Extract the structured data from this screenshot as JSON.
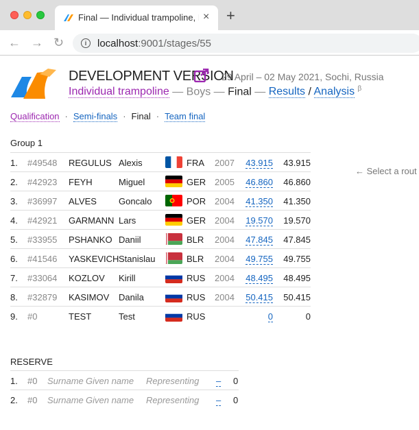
{
  "browser": {
    "tab_title": "Final — Individual trampoline, B",
    "close": "×",
    "new_tab": "+",
    "back": "←",
    "forward": "→",
    "reload": "↻",
    "info": "i",
    "url_host": "localhost",
    "url_path": ":9001/stages/55"
  },
  "header": {
    "title": "DEVELOPMENT VERSION",
    "date_place": "29 April – 02 May 2021, Sochi, Russia",
    "crumb_event": "Individual trampoline",
    "crumb_sep1": " — ",
    "crumb_group": "Boys",
    "crumb_sep2": " — ",
    "crumb_stage": "Final",
    "crumb_sep3": " — ",
    "crumb_results": "Results",
    "crumb_slash": " / ",
    "crumb_analysis": "Analysis",
    "crumb_beta": "β"
  },
  "stage_tabs": {
    "qualification": "Qualification",
    "semi": "Semi-finals",
    "final": "Final",
    "team": "Team final",
    "sep": "·"
  },
  "group": {
    "label": "Group 1",
    "rows": [
      {
        "no": "1.",
        "id": "#49548",
        "surname": "REGULUS",
        "given": "Alexis",
        "flag": "fr",
        "country": "FRA",
        "year": "2007",
        "score": "43.915",
        "total": "43.915"
      },
      {
        "no": "2.",
        "id": "#42923",
        "surname": "FEYH",
        "given": "Miguel",
        "flag": "de",
        "country": "GER",
        "year": "2005",
        "score": "46.860",
        "total": "46.860"
      },
      {
        "no": "3.",
        "id": "#36997",
        "surname": "ALVES",
        "given": "Goncalo",
        "flag": "pt",
        "country": "POR",
        "year": "2004",
        "score": "41.350",
        "total": "41.350"
      },
      {
        "no": "4.",
        "id": "#42921",
        "surname": "GARMANN",
        "given": "Lars",
        "flag": "de",
        "country": "GER",
        "year": "2004",
        "score": "19.570",
        "total": "19.570"
      },
      {
        "no": "5.",
        "id": "#33955",
        "surname": "PSHANKO",
        "given": "Daniil",
        "flag": "by",
        "country": "BLR",
        "year": "2004",
        "score": "47.845",
        "total": "47.845"
      },
      {
        "no": "6.",
        "id": "#41546",
        "surname": "YASKEVICH",
        "given": "Stanislau",
        "flag": "by",
        "country": "BLR",
        "year": "2004",
        "score": "49.755",
        "total": "49.755"
      },
      {
        "no": "7.",
        "id": "#33064",
        "surname": "KOZLOV",
        "given": "Kirill",
        "flag": "ru",
        "country": "RUS",
        "year": "2004",
        "score": "48.495",
        "total": "48.495"
      },
      {
        "no": "8.",
        "id": "#32879",
        "surname": "KASIMOV",
        "given": "Danila",
        "flag": "ru",
        "country": "RUS",
        "year": "2004",
        "score": "50.415",
        "total": "50.415"
      },
      {
        "no": "9.",
        "id": "#0",
        "surname": "TEST",
        "given": "Test",
        "flag": "ru",
        "country": "RUS",
        "year": "",
        "score": "0",
        "total": "0"
      }
    ]
  },
  "hint": "← Select a rout",
  "reserve": {
    "label": "RESERVE",
    "rows": [
      {
        "no": "1.",
        "id": "#0",
        "surname": "Surname",
        "given": "Given name",
        "representing": "Representing",
        "dash": "–",
        "zero": "0"
      },
      {
        "no": "2.",
        "id": "#0",
        "surname": "Surname",
        "given": "Given name",
        "representing": "Representing",
        "dash": "–",
        "zero": "0"
      }
    ]
  },
  "colors": {
    "purple": "#9c27b0",
    "blue": "#1565c0"
  }
}
